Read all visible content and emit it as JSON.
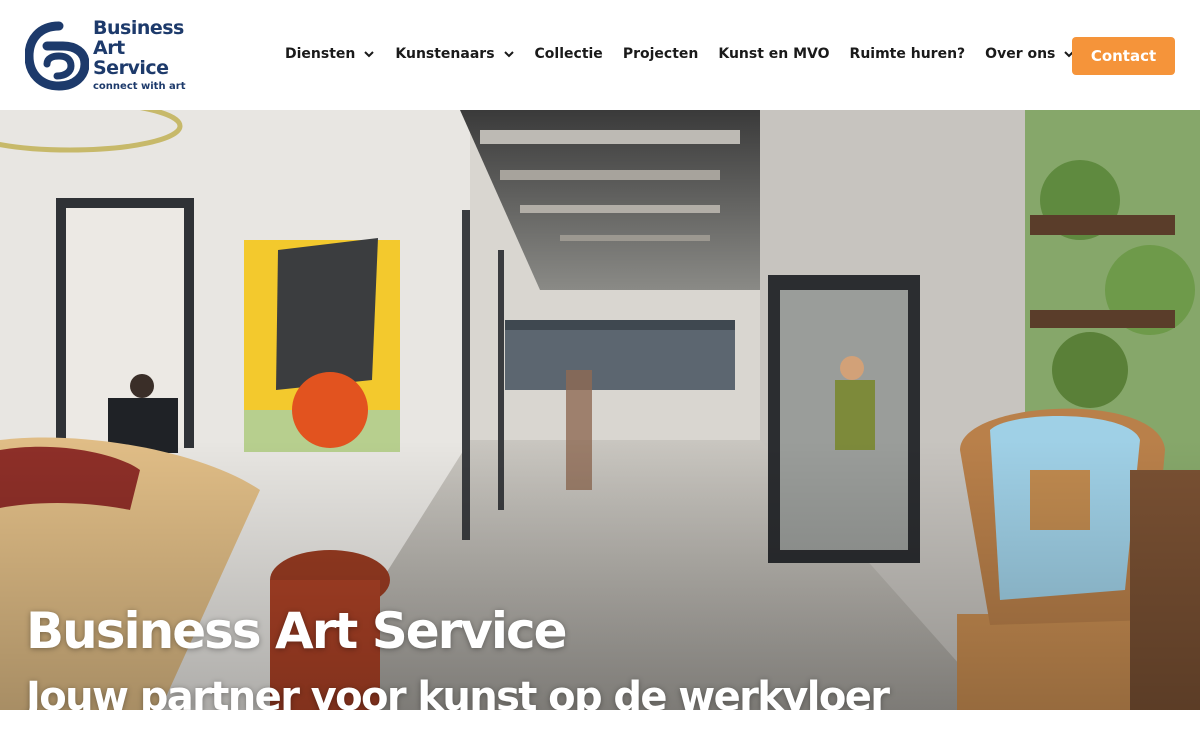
{
  "brand": {
    "line1": "Business",
    "line2": "Art",
    "line3": "Service",
    "tagline": "connect with art",
    "color": "#1d3a6b"
  },
  "nav": {
    "items": [
      {
        "label": "Diensten",
        "dropdown": true
      },
      {
        "label": "Kunstenaars",
        "dropdown": true
      },
      {
        "label": "Collectie",
        "dropdown": false
      },
      {
        "label": "Projecten",
        "dropdown": false
      },
      {
        "label": "Kunst en MVO",
        "dropdown": false
      },
      {
        "label": "Ruimte huren?",
        "dropdown": false
      },
      {
        "label": "Over ons",
        "dropdown": true
      }
    ],
    "contact_label": "Contact",
    "contact_color": "#f5943a"
  },
  "hero": {
    "title": "Business Art Service",
    "subtitle": "Jouw partner voor kunst op de werkvloer",
    "image_icon": "office-photo"
  }
}
